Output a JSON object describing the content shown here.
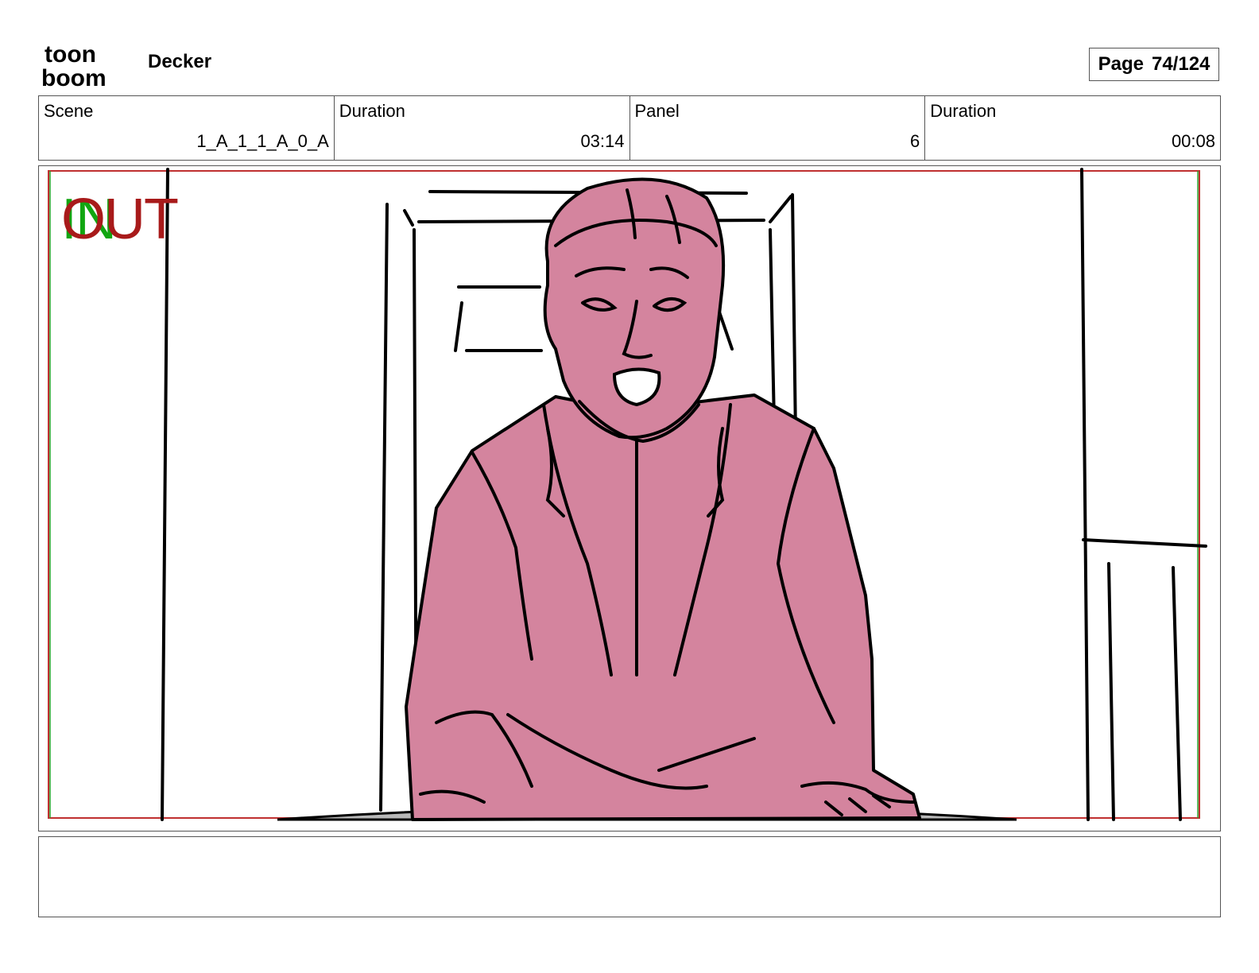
{
  "header": {
    "logo_line1": "toon",
    "logo_line2": "boom",
    "project": "Decker",
    "page_label": "Page",
    "page_value": "74/124"
  },
  "info": {
    "scene_label": "Scene",
    "scene_value": "1_A_1_1_A_0_A",
    "duration_label": "Duration",
    "duration_value": "03:14",
    "panel_label": "Panel",
    "panel_value": "6",
    "panel_duration_label": "Duration",
    "panel_duration_value": "00:08"
  },
  "frame": {
    "in_marker": "IN",
    "out_marker": "OUT",
    "colors": {
      "in": "#11a611",
      "out": "#a81a1a",
      "character_fill": "#d4849e"
    }
  },
  "notes": {
    "text": ""
  }
}
